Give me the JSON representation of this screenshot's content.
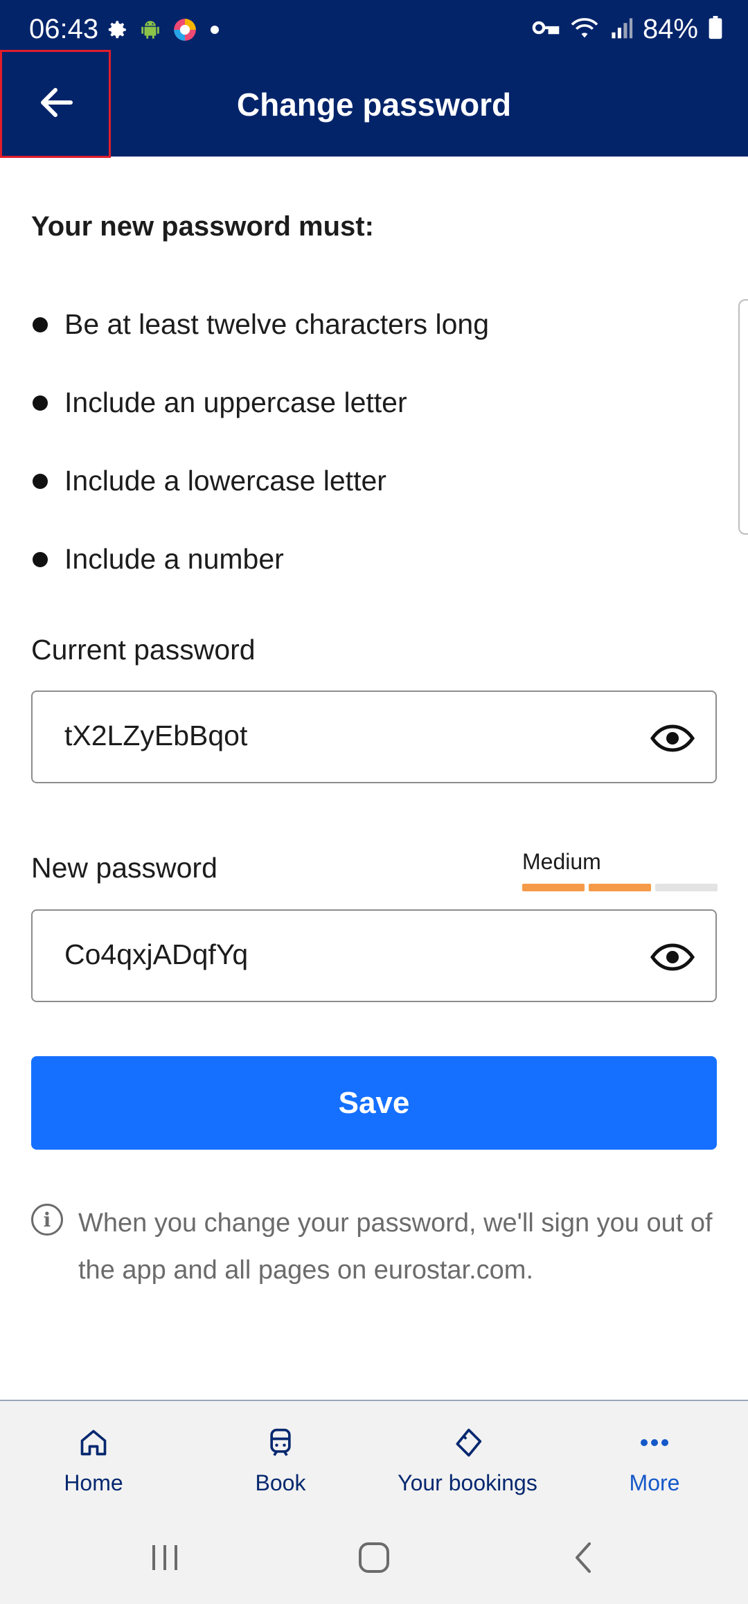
{
  "status_bar": {
    "time": "06:43",
    "battery": "84%",
    "icons": [
      "settings-icon",
      "android-icon",
      "browser-icon",
      "dot-icon",
      "vpn-key-icon",
      "wifi-icon",
      "signal-icon",
      "battery-icon"
    ]
  },
  "app_bar": {
    "title": "Change password",
    "back_icon": "arrow-left-icon"
  },
  "requirements": {
    "heading": "Your new password must:",
    "items": [
      "Be at least twelve characters long",
      "Include an uppercase letter",
      "Include a lowercase letter",
      "Include a number"
    ]
  },
  "current_password": {
    "label": "Current password",
    "value": "tX2LZyEbBqot",
    "toggle_icon": "eye-icon"
  },
  "new_password": {
    "label": "New password",
    "value": "Co4qxjADqfYq",
    "toggle_icon": "eye-icon",
    "strength": {
      "label": "Medium",
      "level": 2,
      "segments": 3,
      "active_color": "#f59a48",
      "inactive_color": "#e3e3e3"
    }
  },
  "save_button": {
    "label": "Save",
    "color": "#1570ff"
  },
  "info": {
    "icon": "info-icon",
    "text": "When you change your password, we'll sign you out of the app and all pages on eurostar.com."
  },
  "bottom_nav": {
    "items": [
      {
        "label": "Home",
        "icon": "home-icon"
      },
      {
        "label": "Book",
        "icon": "train-icon"
      },
      {
        "label": "Your bookings",
        "icon": "ticket-icon"
      },
      {
        "label": "More",
        "icon": "more-dots-icon"
      }
    ],
    "active_index": 3
  },
  "system_nav": {
    "buttons": [
      "recent-apps-icon",
      "home-circle-icon",
      "back-chevron-icon"
    ]
  },
  "colors": {
    "header_bg": "#04246a",
    "nav_text": "#06286f",
    "nav_active": "#1558c8",
    "highlight_border": "#e11d2a"
  }
}
